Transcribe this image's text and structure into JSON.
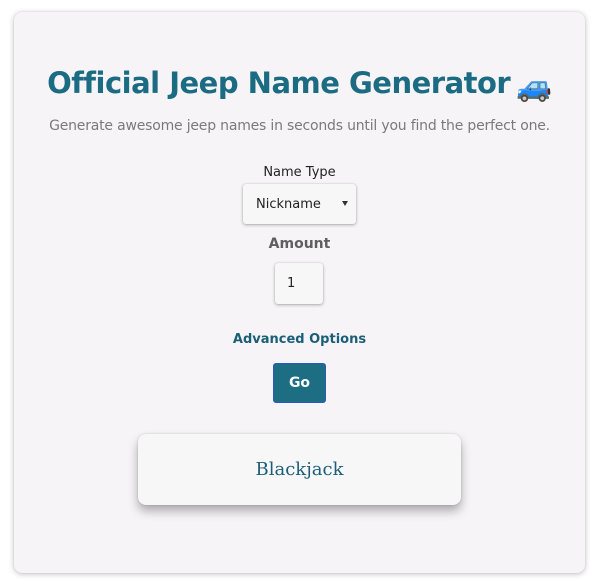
{
  "header": {
    "title": "Official Jeep Name Generator",
    "title_emoji": "🚙",
    "subtitle": "Generate awesome jeep names in seconds until you find the perfect one."
  },
  "form": {
    "name_type_label": "Name Type",
    "name_type_value": "Nickname",
    "amount_label": "Amount",
    "amount_value": "1",
    "advanced_options_label": "Advanced Options",
    "go_label": "Go"
  },
  "result": {
    "names": [
      "Blackjack"
    ]
  },
  "colors": {
    "accent": "#1b6b82",
    "button_bg": "#1d6d83",
    "button_border": "#2b57c9",
    "card_bg": "#f6f4f6",
    "subtitle": "#7a7a7a"
  },
  "icons": {
    "select_caret": "chevron-down-icon",
    "title_emoji": "jeep-icon"
  }
}
